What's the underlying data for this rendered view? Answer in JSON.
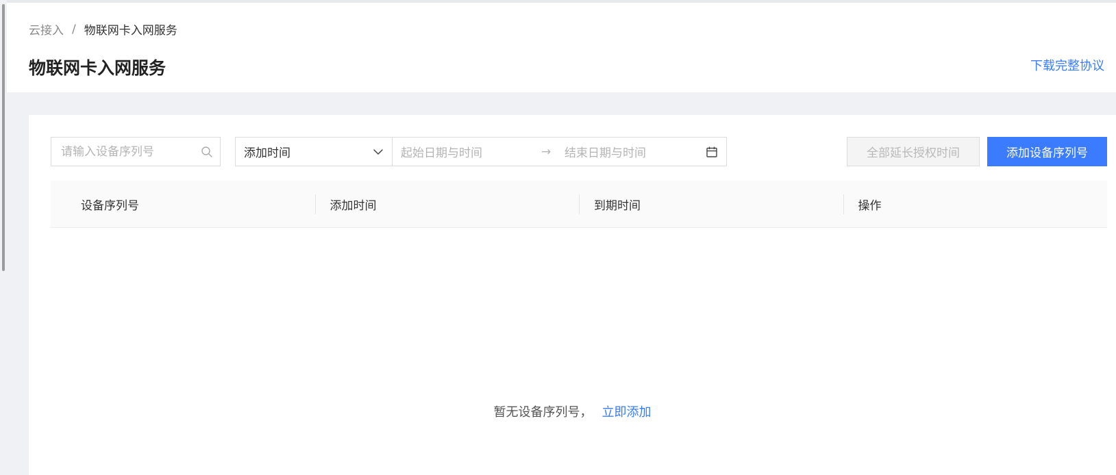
{
  "breadcrumb": {
    "parent": "云接入",
    "separator": "/",
    "current": "物联网卡入网服务"
  },
  "page": {
    "title": "物联网卡入网服务",
    "download_link": "下载完整协议"
  },
  "toolbar": {
    "search_placeholder": "请输入设备序列号",
    "time_select_value": "添加时间",
    "date_start_placeholder": "起始日期与时间",
    "date_arrow": "→",
    "date_end_placeholder": "结束日期与时间",
    "extend_button": "全部延长授权时间",
    "add_button": "添加设备序列号"
  },
  "table": {
    "columns": [
      "设备序列号",
      "添加时间",
      "到期时间",
      "操作"
    ],
    "rows": []
  },
  "empty": {
    "text": "暂无设备序列号，",
    "action": "立即添加"
  },
  "icons": {
    "search": "search-icon",
    "dropdown": "chevron-down-icon",
    "calendar": "calendar-icon"
  },
  "colors": {
    "primary": "#3b7cff",
    "disabled_bg": "#f4f4f4",
    "page_bg": "#f0f1f4"
  }
}
